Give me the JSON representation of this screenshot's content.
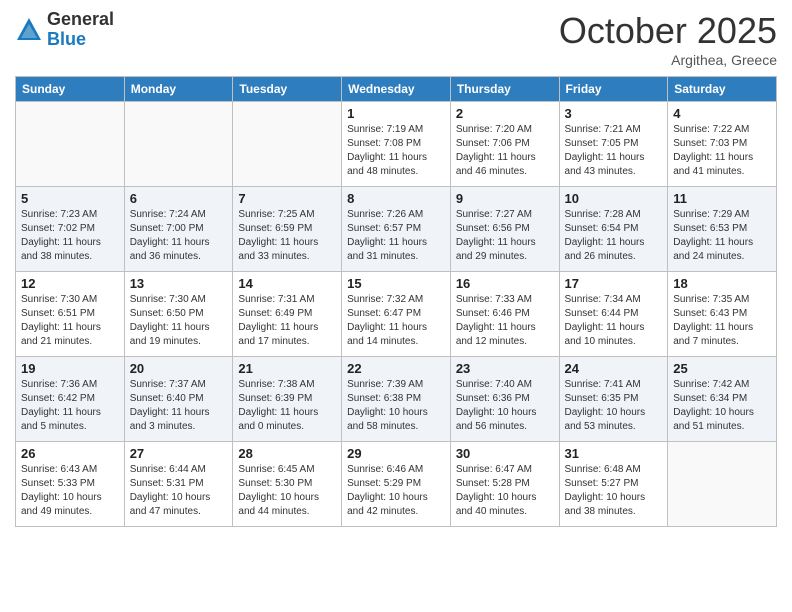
{
  "logo": {
    "general": "General",
    "blue": "Blue"
  },
  "header": {
    "month": "October 2025",
    "location": "Argithea, Greece"
  },
  "days_of_week": [
    "Sunday",
    "Monday",
    "Tuesday",
    "Wednesday",
    "Thursday",
    "Friday",
    "Saturday"
  ],
  "weeks": [
    [
      {
        "day": "",
        "info": ""
      },
      {
        "day": "",
        "info": ""
      },
      {
        "day": "",
        "info": ""
      },
      {
        "day": "1",
        "info": "Sunrise: 7:19 AM\nSunset: 7:08 PM\nDaylight: 11 hours\nand 48 minutes."
      },
      {
        "day": "2",
        "info": "Sunrise: 7:20 AM\nSunset: 7:06 PM\nDaylight: 11 hours\nand 46 minutes."
      },
      {
        "day": "3",
        "info": "Sunrise: 7:21 AM\nSunset: 7:05 PM\nDaylight: 11 hours\nand 43 minutes."
      },
      {
        "day": "4",
        "info": "Sunrise: 7:22 AM\nSunset: 7:03 PM\nDaylight: 11 hours\nand 41 minutes."
      }
    ],
    [
      {
        "day": "5",
        "info": "Sunrise: 7:23 AM\nSunset: 7:02 PM\nDaylight: 11 hours\nand 38 minutes."
      },
      {
        "day": "6",
        "info": "Sunrise: 7:24 AM\nSunset: 7:00 PM\nDaylight: 11 hours\nand 36 minutes."
      },
      {
        "day": "7",
        "info": "Sunrise: 7:25 AM\nSunset: 6:59 PM\nDaylight: 11 hours\nand 33 minutes."
      },
      {
        "day": "8",
        "info": "Sunrise: 7:26 AM\nSunset: 6:57 PM\nDaylight: 11 hours\nand 31 minutes."
      },
      {
        "day": "9",
        "info": "Sunrise: 7:27 AM\nSunset: 6:56 PM\nDaylight: 11 hours\nand 29 minutes."
      },
      {
        "day": "10",
        "info": "Sunrise: 7:28 AM\nSunset: 6:54 PM\nDaylight: 11 hours\nand 26 minutes."
      },
      {
        "day": "11",
        "info": "Sunrise: 7:29 AM\nSunset: 6:53 PM\nDaylight: 11 hours\nand 24 minutes."
      }
    ],
    [
      {
        "day": "12",
        "info": "Sunrise: 7:30 AM\nSunset: 6:51 PM\nDaylight: 11 hours\nand 21 minutes."
      },
      {
        "day": "13",
        "info": "Sunrise: 7:30 AM\nSunset: 6:50 PM\nDaylight: 11 hours\nand 19 minutes."
      },
      {
        "day": "14",
        "info": "Sunrise: 7:31 AM\nSunset: 6:49 PM\nDaylight: 11 hours\nand 17 minutes."
      },
      {
        "day": "15",
        "info": "Sunrise: 7:32 AM\nSunset: 6:47 PM\nDaylight: 11 hours\nand 14 minutes."
      },
      {
        "day": "16",
        "info": "Sunrise: 7:33 AM\nSunset: 6:46 PM\nDaylight: 11 hours\nand 12 minutes."
      },
      {
        "day": "17",
        "info": "Sunrise: 7:34 AM\nSunset: 6:44 PM\nDaylight: 11 hours\nand 10 minutes."
      },
      {
        "day": "18",
        "info": "Sunrise: 7:35 AM\nSunset: 6:43 PM\nDaylight: 11 hours\nand 7 minutes."
      }
    ],
    [
      {
        "day": "19",
        "info": "Sunrise: 7:36 AM\nSunset: 6:42 PM\nDaylight: 11 hours\nand 5 minutes."
      },
      {
        "day": "20",
        "info": "Sunrise: 7:37 AM\nSunset: 6:40 PM\nDaylight: 11 hours\nand 3 minutes."
      },
      {
        "day": "21",
        "info": "Sunrise: 7:38 AM\nSunset: 6:39 PM\nDaylight: 11 hours\nand 0 minutes."
      },
      {
        "day": "22",
        "info": "Sunrise: 7:39 AM\nSunset: 6:38 PM\nDaylight: 10 hours\nand 58 minutes."
      },
      {
        "day": "23",
        "info": "Sunrise: 7:40 AM\nSunset: 6:36 PM\nDaylight: 10 hours\nand 56 minutes."
      },
      {
        "day": "24",
        "info": "Sunrise: 7:41 AM\nSunset: 6:35 PM\nDaylight: 10 hours\nand 53 minutes."
      },
      {
        "day": "25",
        "info": "Sunrise: 7:42 AM\nSunset: 6:34 PM\nDaylight: 10 hours\nand 51 minutes."
      }
    ],
    [
      {
        "day": "26",
        "info": "Sunrise: 6:43 AM\nSunset: 5:33 PM\nDaylight: 10 hours\nand 49 minutes."
      },
      {
        "day": "27",
        "info": "Sunrise: 6:44 AM\nSunset: 5:31 PM\nDaylight: 10 hours\nand 47 minutes."
      },
      {
        "day": "28",
        "info": "Sunrise: 6:45 AM\nSunset: 5:30 PM\nDaylight: 10 hours\nand 44 minutes."
      },
      {
        "day": "29",
        "info": "Sunrise: 6:46 AM\nSunset: 5:29 PM\nDaylight: 10 hours\nand 42 minutes."
      },
      {
        "day": "30",
        "info": "Sunrise: 6:47 AM\nSunset: 5:28 PM\nDaylight: 10 hours\nand 40 minutes."
      },
      {
        "day": "31",
        "info": "Sunrise: 6:48 AM\nSunset: 5:27 PM\nDaylight: 10 hours\nand 38 minutes."
      },
      {
        "day": "",
        "info": ""
      }
    ]
  ]
}
